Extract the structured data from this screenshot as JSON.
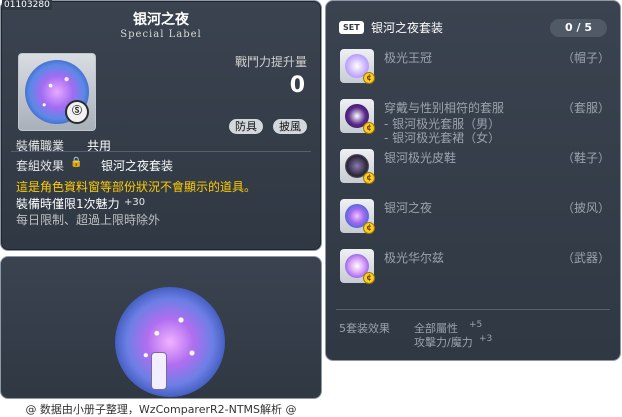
{
  "item": {
    "id": "01103280",
    "name": "银河之夜",
    "label": "Special Label",
    "icon": "galaxy-night-cape-icon",
    "badge": "Ⓢ",
    "power_label": "戰鬥力提升量",
    "power_value": "0",
    "tags": [
      "防具",
      "披風"
    ],
    "job_label": "裝備職業",
    "job_value": "共用",
    "set_label": "套組效果",
    "set_lock": "🔒",
    "set_value": "银河之夜套装",
    "warning": "這是角色資料窗等部份狀況不會顯示的道具。",
    "equip_line": "裝備時僅限1次魅力",
    "equip_bonus": "+30",
    "limit_line": "每日限制、超過上限時除外"
  },
  "set": {
    "badge": "SET",
    "title": "银河之夜套装",
    "count": "0 / 5",
    "items": [
      {
        "name": "极光王冠",
        "slot": "（帽子）",
        "icon": "crown-icon"
      },
      {
        "name": "穿戴与性别相符的套服",
        "slot": "（套服）",
        "icon": "suit-icon",
        "sub": [
          "- 银河极光套服（男）",
          "- 银河极光套裙（女）"
        ]
      },
      {
        "name": "银河极光皮鞋",
        "slot": "（鞋子）",
        "icon": "shoes-icon"
      },
      {
        "name": "银河之夜",
        "slot": "（披风）",
        "icon": "cape-icon"
      },
      {
        "name": "极光华尔兹",
        "slot": "（武器）",
        "icon": "weapon-icon"
      }
    ],
    "effect_label": "5套装效果",
    "effects": [
      {
        "name": "全部屬性",
        "value": "+5"
      },
      {
        "name": "攻擊力/魔力",
        "value": "+3"
      }
    ]
  },
  "footer": "@ 数据由小册子整理，WzComparerR2-NTMS解析 @",
  "colors": {
    "panel_bg": "#333c47",
    "warning": "#ffcc00",
    "muted": "#9aa3ad"
  }
}
